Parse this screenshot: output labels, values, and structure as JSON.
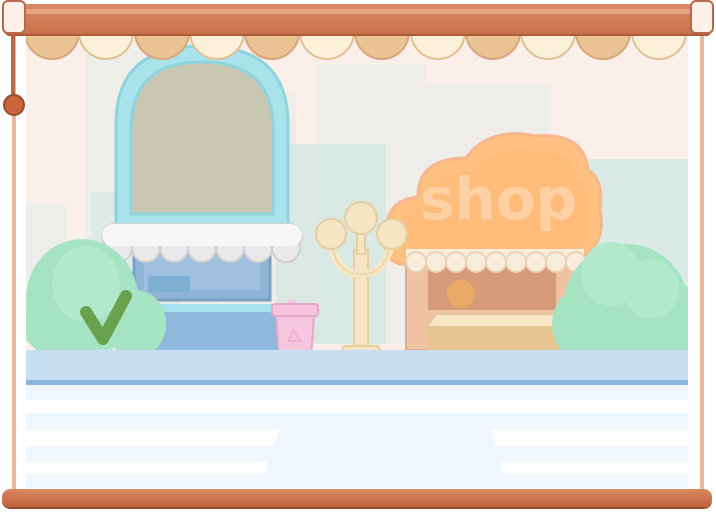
{
  "shop_sign": {
    "label": "shop"
  },
  "colors": {
    "frame_wood": "#c9714a",
    "scene_background": "#fbefe9",
    "kiosk_dome": "#a8e2ea",
    "shop_cloud": "#ffc182",
    "bushes": "#a6e3c2",
    "street": "#c9def2",
    "trash_can": "#f6c6df"
  },
  "icons": [
    "checkmark-icon",
    "recycle-icon",
    "pull-cord-knob"
  ]
}
